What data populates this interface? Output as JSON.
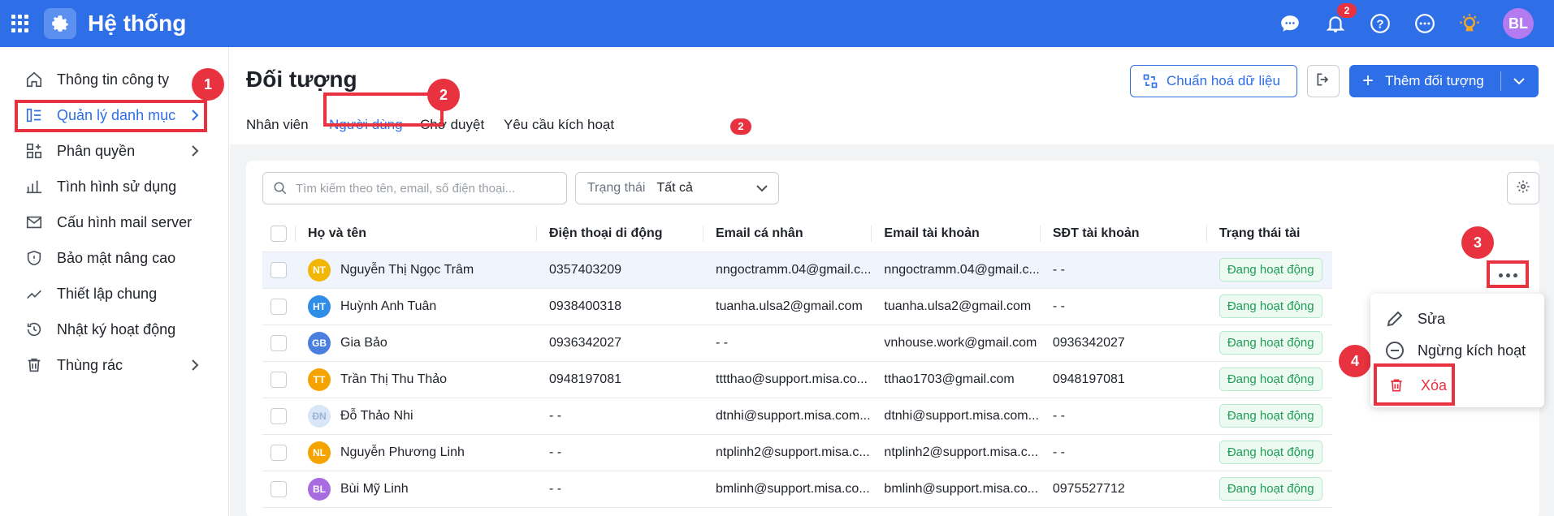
{
  "app": {
    "title": "Hệ thống",
    "notification_count": "2",
    "user_initials": "BL"
  },
  "sidebar": {
    "items": [
      {
        "label": "Thông tin công ty",
        "icon": "home-icon"
      },
      {
        "label": "Quản lý danh mục",
        "icon": "category-icon"
      },
      {
        "label": "Phân quyền",
        "icon": "permission-icon"
      },
      {
        "label": "Tình hình sử dụng",
        "icon": "usage-chart-icon"
      },
      {
        "label": "Cấu hình mail server",
        "icon": "mail-icon"
      },
      {
        "label": "Bảo mật nâng cao",
        "icon": "shield-icon"
      },
      {
        "label": "Thiết lập chung",
        "icon": "trend-icon"
      },
      {
        "label": "Nhật ký hoạt động",
        "icon": "history-icon"
      },
      {
        "label": "Thùng rác",
        "icon": "trash-icon"
      }
    ]
  },
  "steps": [
    "1",
    "2",
    "3",
    "4"
  ],
  "page": {
    "title": "Đối tượng",
    "normalize_label": "Chuẩn hoá dữ liệu",
    "add_label": "Thêm đối tượng",
    "tabs": [
      {
        "label": "Nhân viên"
      },
      {
        "label": "Người dùng"
      },
      {
        "label": "Chờ duyệt"
      },
      {
        "label": "Yêu cầu kích hoạt"
      }
    ],
    "tab_badge": "2"
  },
  "toolbar": {
    "search_placeholder": "Tìm kiếm theo tên, email, số điện thoại...",
    "filter_label": "Trạng thái",
    "filter_value": "Tất cả"
  },
  "table": {
    "columns": [
      "Họ và tên",
      "Điện thoại di động",
      "Email cá nhân",
      "Email tài khoản",
      "SĐT tài khoản",
      "Trạng thái tài"
    ],
    "rows": [
      {
        "initials": "NT",
        "color": "#f2b705",
        "name": "Nguyễn Thị Ngọc Trâm",
        "phone": "0357403209",
        "email": "nngoctramm.04@gmail.c...",
        "account_email": "nngoctramm.04@gmail.c...",
        "account_phone": "- -",
        "status": "Đang hoạt động"
      },
      {
        "initials": "HT",
        "color": "#2e8de6",
        "name": "Huỳnh Anh Tuân",
        "phone": "0938400318",
        "email": "tuanha.ulsa2@gmail.com",
        "account_email": "tuanha.ulsa2@gmail.com",
        "account_phone": "- -",
        "status": "Đang hoạt động"
      },
      {
        "initials": "GB",
        "color": "#4a7fe0",
        "name": "Gia Bảo",
        "phone": "0936342027",
        "email": "- -",
        "account_email": "vnhouse.work@gmail.com",
        "account_phone": "0936342027",
        "status": "Đang hoạt động"
      },
      {
        "initials": "TT",
        "color": "#f5a300",
        "name": "Trần Thị Thu Thảo",
        "phone": "0948197081",
        "email": "tttthao@support.misa.co...",
        "account_email": "tthao1703@gmail.com",
        "account_phone": "0948197081",
        "status": "Đang hoạt động"
      },
      {
        "initials": "ĐN",
        "color": "#d9e6f7",
        "name": "Đỗ Thảo Nhi",
        "phone": "- -",
        "email": "dtnhi@support.misa.com...",
        "account_email": "dtnhi@support.misa.com...",
        "account_phone": "- -",
        "status": "Đang hoạt động"
      },
      {
        "initials": "NL",
        "color": "#f5a300",
        "name": "Nguyễn Phương Linh",
        "phone": "- -",
        "email": "ntplinh2@support.misa.c...",
        "account_email": "ntplinh2@support.misa.c...",
        "account_phone": "- -",
        "status": "Đang hoạt động"
      },
      {
        "initials": "BL",
        "color": "#a86be0",
        "name": "Bùi Mỹ Linh",
        "phone": "- -",
        "email": "bmlinh@support.misa.co...",
        "account_email": "bmlinh@support.misa.co...",
        "account_phone": "0975527712",
        "status": "Đang hoạt động"
      }
    ]
  },
  "context_menu": {
    "items": [
      {
        "label": "Sửa",
        "icon": "pencil-icon"
      },
      {
        "label": "Ngừng kích hoạt",
        "icon": "minus-circle-icon"
      },
      {
        "label": "Xóa",
        "icon": "trash-icon"
      }
    ]
  }
}
